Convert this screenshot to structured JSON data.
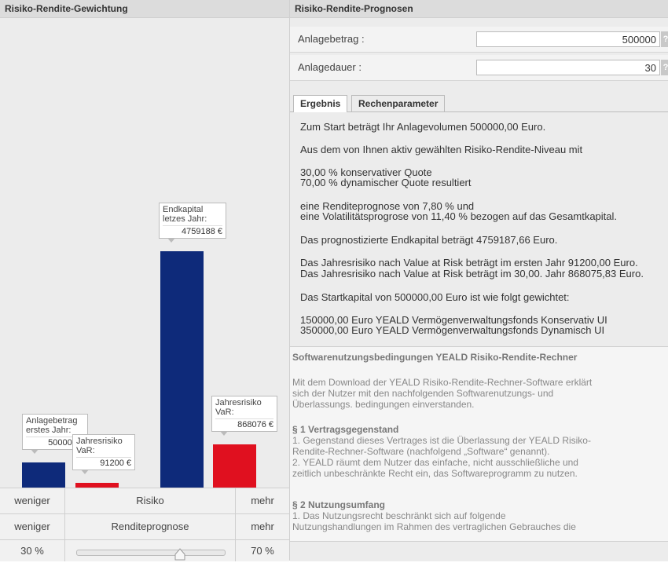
{
  "left_header": "Risiko-Rendite-Gewichtung",
  "right_header": "Risiko-Rendite-Prognosen",
  "chart_data": {
    "type": "bar",
    "categories": [
      "Anlagebetrag erstes Jahr",
      "Jahresrisiko VaR (erstes Jahr)",
      "Endkapital letzes Jahr",
      "Jahresrisiko VaR (letztes Jahr)"
    ],
    "values": [
      500000,
      91200,
      4759188,
      868076
    ],
    "colors": [
      "#0e2a7a",
      "#e0101f",
      "#0e2a7a",
      "#e0101f"
    ],
    "labels": [
      {
        "line1": "Anlagebetrag",
        "line2": "erstes Jahr:",
        "value": "500000 €"
      },
      {
        "line1": "Jahresrisiko",
        "line2": "VaR:",
        "value": "91200 €"
      },
      {
        "line1": "Endkapital",
        "line2": "letzes Jahr:",
        "value": "4759188 €"
      },
      {
        "line1": "Jahresrisiko",
        "line2": "VaR:",
        "value": "868076 €"
      }
    ],
    "ymax": 9440000
  },
  "controls": {
    "risk": {
      "left": "weniger",
      "center": "Risiko",
      "right": "mehr"
    },
    "return": {
      "left": "weniger",
      "center": "Renditeprognose",
      "right": "mehr"
    },
    "slider": {
      "left": "30 %",
      "right": "70 %",
      "value": 0.7
    }
  },
  "fields": {
    "amount": {
      "label": "Anlagebetrag :",
      "value": "500000",
      "help": "?"
    },
    "duration": {
      "label": "Anlagedauer :",
      "value": "30",
      "help": "?"
    }
  },
  "tabs": {
    "result": "Ergebnis",
    "params": "Rechenparameter"
  },
  "result_lines": [
    "Zum Start beträgt Ihr Anlagevolumen 500000,00 Euro.",
    "Aus dem von Ihnen aktiv gewählten Risiko-Rendite-Niveau mit",
    "30,00 % konservativer Quote",
    "70,00 % dynamischer Quote resultiert",
    "eine Renditeprognose von 7,80 % und",
    "eine Volatilitätsprogrose von 11,40 % bezogen auf das Gesamtkapital.",
    "Das prognostizierte Endkapital beträgt 4759187,66 Euro.",
    "Das Jahresrisiko nach Value at Risk beträgt im ersten Jahr 91200,00 Euro.",
    "Das Jahresrisiko nach Value at Risk beträgt im 30,00. Jahr 868075,83 Euro.",
    "Das Startkapital von 500000,00 Euro ist wie folgt gewichtet:",
    "150000,00 Euro YEALD Vermögenverwaltungsfonds Konservativ UI",
    "350000,00 Euro YEALD Vermögenverwaltungsfonds Dynamisch UI"
  ],
  "terms": {
    "title": "Softwarenutzungsbedingungen YEALD Risiko-Rendite-Rechner",
    "intro": [
      "Mit dem Download der YEALD Risiko-Rendite-Rechner-Software erklärt",
      "sich der Nutzer mit den nachfolgenden Softwarenutzungs- und",
      "Überlassungs. bedingungen einverstanden."
    ],
    "s1_title": "§ 1 Vertragsgegenstand",
    "s1": [
      "1. Gegenstand dieses Vertrages ist die Überlassung der YEALD Risiko-",
      "Rendite-Rechner-Software (nachfolgend „Software“ genannt).",
      "2. YEALD räumt dem Nutzer das einfache, nicht ausschließliche und",
      "zeitlich unbeschränkte Recht ein, das Softwareprogramm zu nutzen."
    ],
    "s2_title": "§ 2 Nutzungsumfang",
    "s2": [
      "1. Das Nutzungsrecht beschränkt sich auf folgende",
      "Nutzungshandlungen im Rahmen des vertraglichen Gebrauches die"
    ]
  }
}
